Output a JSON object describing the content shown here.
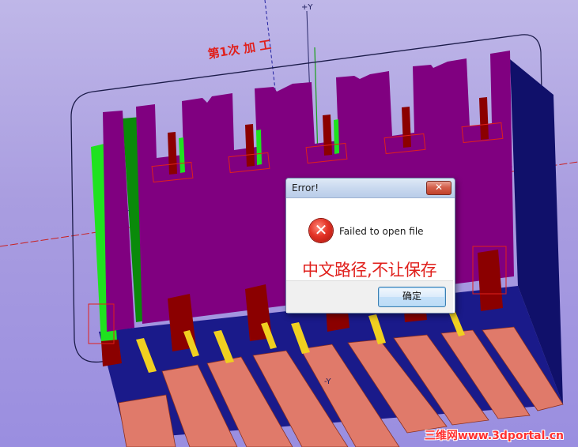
{
  "viewport": {
    "axis_y_pos": "+Y",
    "axis_y_neg": "-Y",
    "stage_label": "第1次 加 工",
    "colors": {
      "purple": "#800080",
      "green": "#0a8a0a",
      "bright_green": "#1fe21f",
      "dark_red": "#8b0000",
      "navy": "#1a1a8a",
      "salmon": "#e07a6a",
      "yellow": "#f0d020",
      "axis_red": "#c82020"
    }
  },
  "dialog": {
    "title": "Error!",
    "close_label": "✕",
    "icon": "error-x-icon",
    "message": "Failed to open file",
    "ok_label": "确定"
  },
  "annotation": "中文路径,不让保存",
  "watermark": "三维网www.3dportal.cn"
}
